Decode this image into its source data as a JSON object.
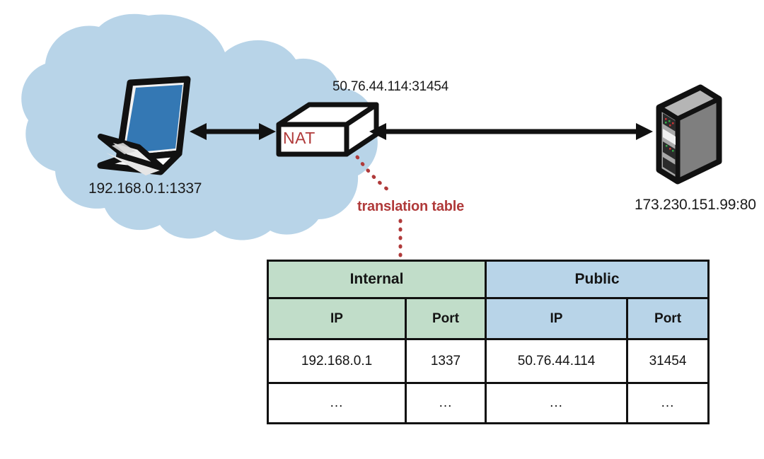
{
  "diagram": {
    "title": "NAT translation diagram",
    "colors": {
      "cloud": "#b8d4e8",
      "laptop_screen": "#3478b4",
      "accent_red": "#b03a3a",
      "table_internal": "#c1ddc9",
      "table_public": "#b8d4e8",
      "server_body": "#9a9a9a",
      "outline": "#111111"
    },
    "nodes": {
      "client": {
        "icon": "laptop-icon",
        "label": "192.168.0.1:1337"
      },
      "nat": {
        "icon": "nat-box-icon",
        "box_label": "NAT",
        "public_address": "50.76.44.114:31454"
      },
      "server": {
        "icon": "server-icon",
        "label": "173.230.151.99:80"
      }
    },
    "callout": {
      "label": "translation table",
      "connector": "dotted-leader-line"
    },
    "connections": [
      {
        "name": "client-to-nat",
        "style": "double-arrow"
      },
      {
        "name": "nat-to-server",
        "style": "double-arrow"
      }
    ]
  },
  "table": {
    "name": "translation-table",
    "group_headers": [
      {
        "label": "Internal",
        "span": 2,
        "fill": "internal"
      },
      {
        "label": "Public",
        "span": 2,
        "fill": "public"
      }
    ],
    "sub_headers": [
      {
        "label": "IP",
        "fill": "internal"
      },
      {
        "label": "Port",
        "fill": "internal"
      },
      {
        "label": "IP",
        "fill": "public"
      },
      {
        "label": "Port",
        "fill": "public"
      }
    ],
    "rows": [
      {
        "internal_ip": "192.168.0.1",
        "internal_port": "1337",
        "public_ip": "50.76.44.114",
        "public_port": "31454"
      },
      {
        "internal_ip": "...",
        "internal_port": "...",
        "public_ip": "...",
        "public_port": "..."
      }
    ]
  }
}
